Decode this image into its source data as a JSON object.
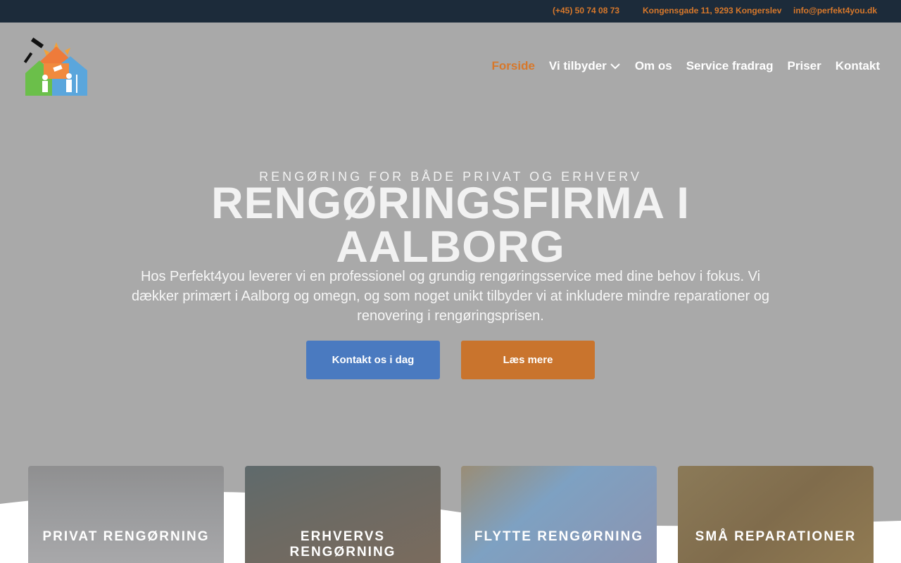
{
  "topbar": {
    "phone": "(+45) 50 74 08 73",
    "address": "Kongensgade 11, 9293 Kongerslev",
    "email": "info@perfekt4you.dk"
  },
  "nav": {
    "items": [
      {
        "label": "Forside",
        "active": true
      },
      {
        "label": "Vi tilbyder",
        "has_dropdown": true
      },
      {
        "label": "Om os"
      },
      {
        "label": "Service fradrag"
      },
      {
        "label": "Priser"
      },
      {
        "label": "Kontakt"
      }
    ]
  },
  "hero": {
    "eyebrow": "RENGØRING FOR BÅDE PRIVAT OG ERHVERV",
    "title": "RENGØRINGSFIRMA I AALBORG",
    "lead": "Hos Perfekt4you leverer vi en professionel og grundig rengøringsservice med dine behov i fokus. Vi dækker primært i Aalborg og omegn, og som noget unikt tilbyder vi at inkludere mindre reparationer og renovering i rengøringsprisen.",
    "btn_contact": "Kontakt os i dag",
    "btn_more": "Læs mere"
  },
  "cards": [
    {
      "label": "PRIVAT RENGØRNING"
    },
    {
      "label": "ERHVERVS RENGØRNING"
    },
    {
      "label": "FLYTTE RENGØRNING"
    },
    {
      "label": "SMÅ REPARATIONER"
    }
  ],
  "colors": {
    "topbar_bg": "#1c2b3a",
    "accent_orange": "#d7782b",
    "button_blue": "#4a7ac0",
    "button_orange": "#c9742d",
    "hero_bg": "#a9a9a9"
  },
  "icons": {
    "logo": "house-cleaning-logo",
    "dropdown": "chevron-down-icon"
  }
}
